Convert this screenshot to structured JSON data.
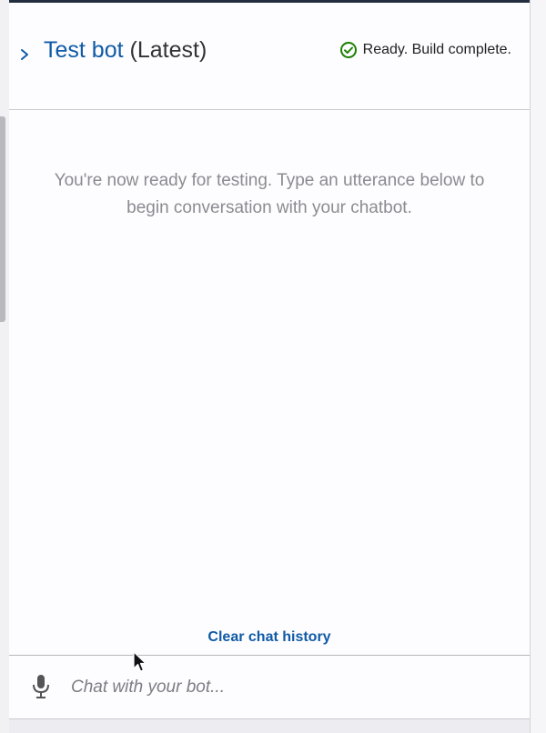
{
  "header": {
    "title_name": "Test bot",
    "title_version": "(Latest)",
    "status_text": "Ready. Build complete.",
    "status_color": "#1d8102"
  },
  "main": {
    "empty_message": "You're now ready for testing. Type an utterance below to begin conversation with your chatbot."
  },
  "footer": {
    "clear_history_label": "Clear chat history",
    "chat_placeholder": "Chat with your bot...",
    "chat_value": ""
  },
  "icons": {
    "expand": "chevron-right-icon",
    "status": "check-circle-icon",
    "mic": "microphone-icon",
    "cursor": "mouse-pointer-icon"
  },
  "colors": {
    "link": "#0f5ba7",
    "top_bar": "#232f3e"
  }
}
